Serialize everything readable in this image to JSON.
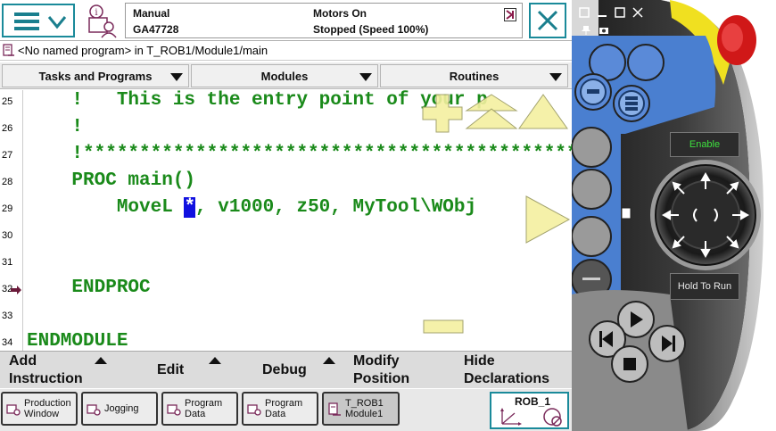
{
  "topbar": {
    "mode": "Manual",
    "controller": "GA47728",
    "motors": "Motors On",
    "state": "Stopped (Speed 100%)"
  },
  "path": "<No named program> in T_ROB1/Module1/main",
  "menus": [
    {
      "label": "Tasks and Programs"
    },
    {
      "label": "Modules"
    },
    {
      "label": "Routines"
    }
  ],
  "lines": [
    {
      "num": "25",
      "text": "    !   This is the entry point of your p"
    },
    {
      "num": "26",
      "text": "    !"
    },
    {
      "num": "27",
      "text": "    !**************************************************"
    },
    {
      "num": "28",
      "text": "    PROC main()"
    },
    {
      "num": "29",
      "pre": "        MoveL ",
      "sel": "*",
      "post": ", v1000, z50, MyTool\\WObj"
    },
    {
      "num": "30",
      "text": ""
    },
    {
      "num": "31",
      "text": ""
    },
    {
      "num": "32",
      "text": "    ENDPROC"
    },
    {
      "num": "33",
      "text": ""
    },
    {
      "num": "34",
      "text": "ENDMODULE"
    }
  ],
  "bottom": {
    "add_instruction_1": "Add",
    "add_instruction_2": "Instruction",
    "edit": "Edit",
    "debug": "Debug",
    "modify_1": "Modify",
    "modify_2": "Position",
    "hide_1": "Hide",
    "hide_2": "Declarations"
  },
  "tasks": [
    {
      "l1": "Production",
      "l2": "Window"
    },
    {
      "l1": "Jogging",
      "l2": ""
    },
    {
      "l1": "Program",
      "l2": "Data"
    },
    {
      "l1": "Program",
      "l2": "Data"
    },
    {
      "l1": "T_ROB1",
      "l2": "Module1"
    }
  ],
  "rob": "ROB_1",
  "device": {
    "enable": "Enable",
    "hold_to_run": "Hold To Run"
  },
  "colors": {
    "accent": "#1a8a9a",
    "code": "#1a8a1a",
    "selection": "#1010e0",
    "device_yellow": "#f0e020",
    "device_red": "#d01818",
    "device_blue": "#4a7fd0"
  }
}
